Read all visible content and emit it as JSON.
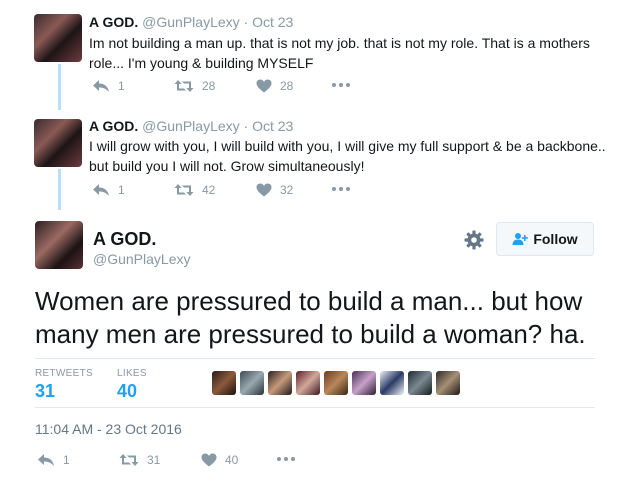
{
  "thread": [
    {
      "name": "A GOD.",
      "handle": "@GunPlayLexy",
      "date": "· Oct 23",
      "text": "Im not building a man up. that is not my job. that is not my role. That is a mothers role... I'm young & building MYSELF",
      "replies": "1",
      "retweets": "28",
      "likes": "28"
    },
    {
      "name": "A GOD.",
      "handle": "@GunPlayLexy",
      "date": "· Oct 23",
      "text": "I will grow with you, I will build with you, I will give my full support & be a backbone.. but build you I will not. Grow simultaneously!",
      "replies": "1",
      "retweets": "42",
      "likes": "32"
    }
  ],
  "main": {
    "name": "A GOD.",
    "handle": "@GunPlayLexy",
    "follow_label": "Follow",
    "text": "Women are pressured to build a man... but how many men are pressured to build a woman? ha.",
    "retweets_label": "RETWEETS",
    "retweets": "31",
    "likes_label": "LIKES",
    "likes": "40",
    "timestamp": "11:04 AM - 23 Oct 2016",
    "replies": "1",
    "action_retweets": "31",
    "action_likes": "40"
  },
  "colors": {
    "accent": "#1da1f2",
    "muted": "#8899a6",
    "thread_line": "#b7e0f7"
  },
  "icons": [
    "reply-icon",
    "retweet-icon",
    "heart-icon",
    "more-icon",
    "gear-icon",
    "follow-person-icon"
  ]
}
